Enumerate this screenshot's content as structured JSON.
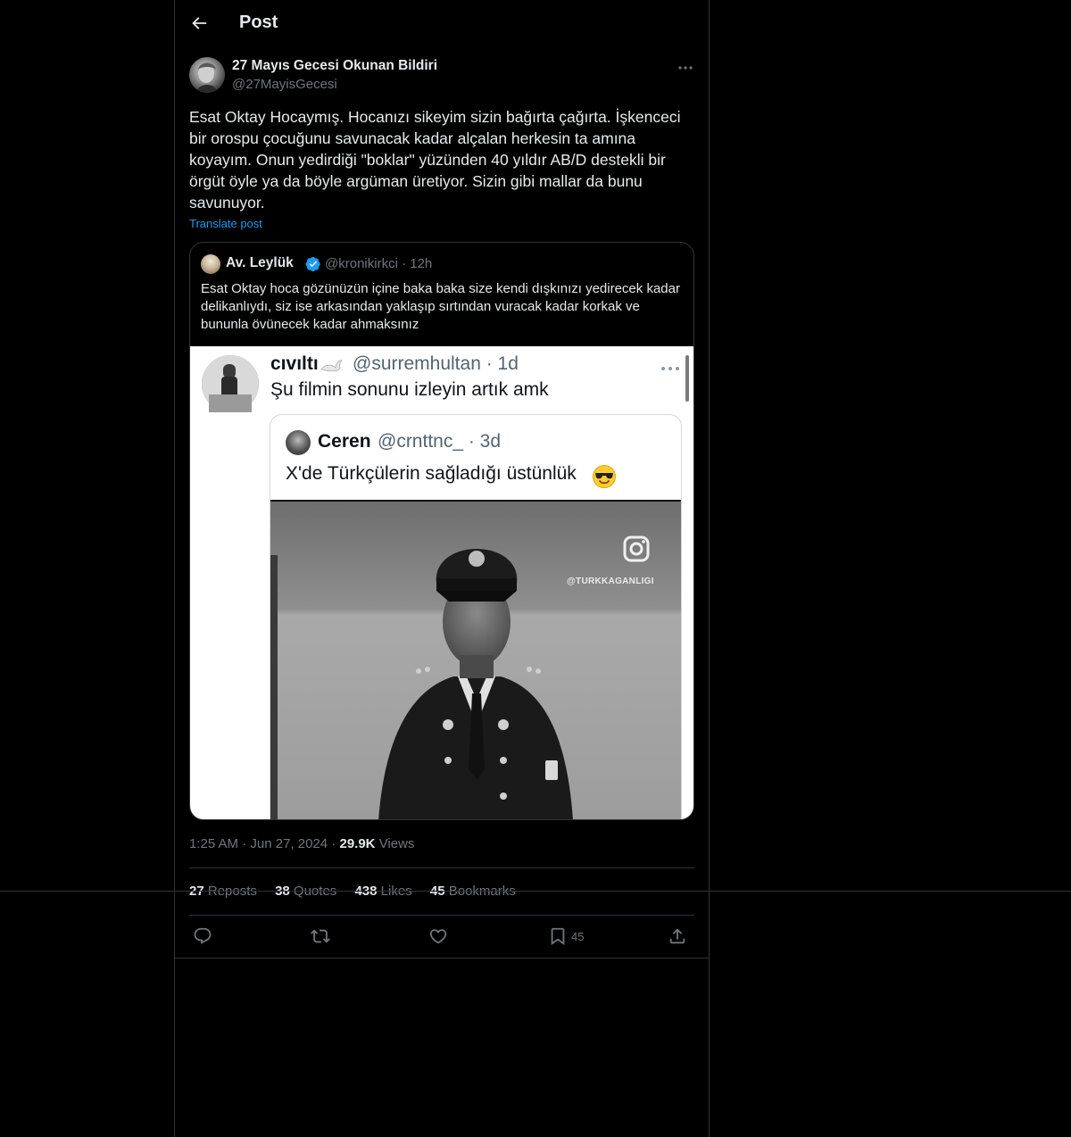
{
  "header": {
    "title": "Post",
    "back_icon": "back-arrow-icon"
  },
  "post": {
    "author": {
      "display_name": "27 Mayıs Gecesi Okunan Bildiri",
      "handle": "@27MayisGecesi"
    },
    "text": "Esat Oktay Hocaymış. Hocanızı sikeyim sizin bağırta çağırta. İşkenceci bir orospu çocuğunu savunacak kadar alçalan herkesin ta amına koyayım. Onun yedirdiği \"boklar\" yüzünden 40 yıldır AB/D destekli bir örgüt öyle ya da böyle argüman üretiyor. Sizin gibi mallar da bunu savunuyor.",
    "translate_label": "Translate post",
    "quoted": {
      "display_name": "Av. Leylük",
      "handle_time": "@kronikirkci · 12h",
      "verified_color": "#1d9bf0",
      "text": "Esat Oktay hoca gözünüzün içine baka baka size kendi dışkınızı yedirecek kadar delikanlıydı, siz ise arkasından yaklaşıp sırtından vuracak kadar korkak ve bununla övünecek kadar ahmaksınız",
      "media": {
        "outer_name": "cıvıltı",
        "outer_handle_time": "@surremhultan · 1d",
        "outer_text": "Şu filmin sonunu izleyin artık amk",
        "inner_name": "Ceren",
        "inner_handle_time": "@crnttnc_ · 3d",
        "inner_text": "X'de Türkçülerin sağladığı üstünlük",
        "watermark": "@TURKKAGANLIGI"
      }
    },
    "meta": {
      "time": "1:25 AM",
      "date": "Jun 27, 2024",
      "views_count": "29.9K",
      "views_label": "Views"
    },
    "stats": {
      "reposts_count": "27",
      "reposts_label": "Reposts",
      "quotes_count": "38",
      "quotes_label": "Quotes",
      "likes_count": "438",
      "likes_label": "Likes",
      "bookmarks_count": "45",
      "bookmarks_label": "Bookmarks"
    },
    "actions": {
      "bookmark_count": "45"
    }
  },
  "colors": {
    "background": "#000000",
    "text": "#e7e9ea",
    "muted": "#71767b",
    "border": "#2f3336",
    "accent": "#1d9bf0"
  }
}
